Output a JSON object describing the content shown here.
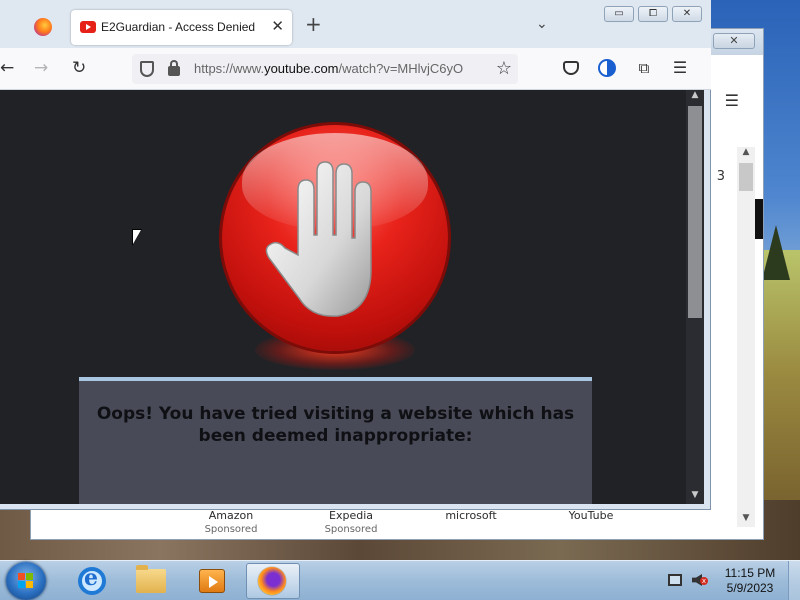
{
  "browser": {
    "tab": {
      "title": "E2Guardian - Access Denied",
      "close": "✕"
    },
    "new_tab": "+",
    "tab_list": "⌄",
    "window_buttons": {
      "minimize": "▭",
      "maximize": "⧠",
      "close": "✕"
    },
    "nav": {
      "back": "←",
      "forward": "→",
      "reload": "↻"
    },
    "url": {
      "prefix": "https://www.",
      "domain": "youtube.com",
      "path": "/watch?v=MHlvjC6yO"
    },
    "toolbar": {
      "star": "☆",
      "extensions": "⧉",
      "menu": "☰"
    }
  },
  "page": {
    "message": "Oops! You have tried visiting a website which has been deemed inappropriate:",
    "scroll_up": "▲",
    "scroll_down": "▼"
  },
  "background_window": {
    "close": "✕",
    "menu": "☰",
    "fragment": "3",
    "scroll_up": "▲",
    "scroll_down": "▼",
    "shortcuts": [
      {
        "label": "Amazon",
        "sub": "Sponsored"
      },
      {
        "label": "Expedia",
        "sub": "Sponsored"
      },
      {
        "label": "microsoft",
        "sub": ""
      },
      {
        "label": "YouTube",
        "sub": ""
      }
    ]
  },
  "taskbar": {
    "apps": [
      "internet-explorer",
      "windows-explorer",
      "media-player",
      "firefox"
    ],
    "clock": {
      "time": "11:15 PM",
      "date": "5/9/2023"
    },
    "volume_muted": "x"
  },
  "colors": {
    "page_bg": "#212226",
    "stop_red": "#e8231b",
    "message_box": "#484a57"
  }
}
